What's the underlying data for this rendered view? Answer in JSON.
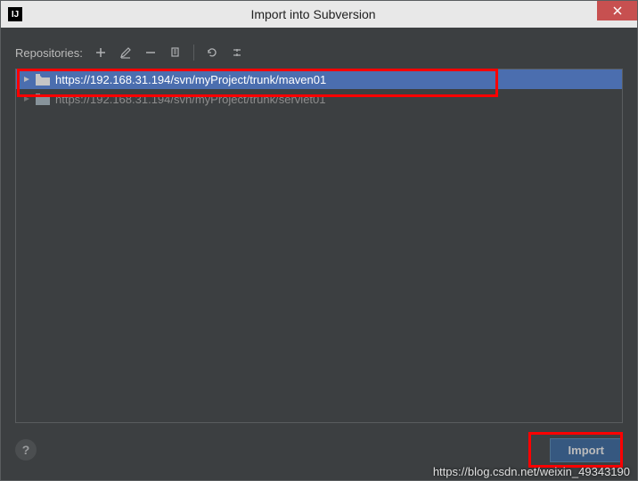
{
  "titlebar": {
    "title": "Import into Subversion"
  },
  "toolbar": {
    "label": "Repositories:",
    "icons": [
      "add",
      "edit",
      "remove",
      "copy",
      "refresh",
      "merge"
    ]
  },
  "tree": {
    "items": [
      {
        "url": "https://192.168.31.194/svn/myProject/trunk/maven01",
        "selected": true
      },
      {
        "url": "https://192.168.31.194/svn/myProject/trunk/servlet01",
        "selected": false
      }
    ]
  },
  "footer": {
    "help": "?",
    "import_label": "Import"
  },
  "watermark": "https://blog.csdn.net/weixin_49343190"
}
